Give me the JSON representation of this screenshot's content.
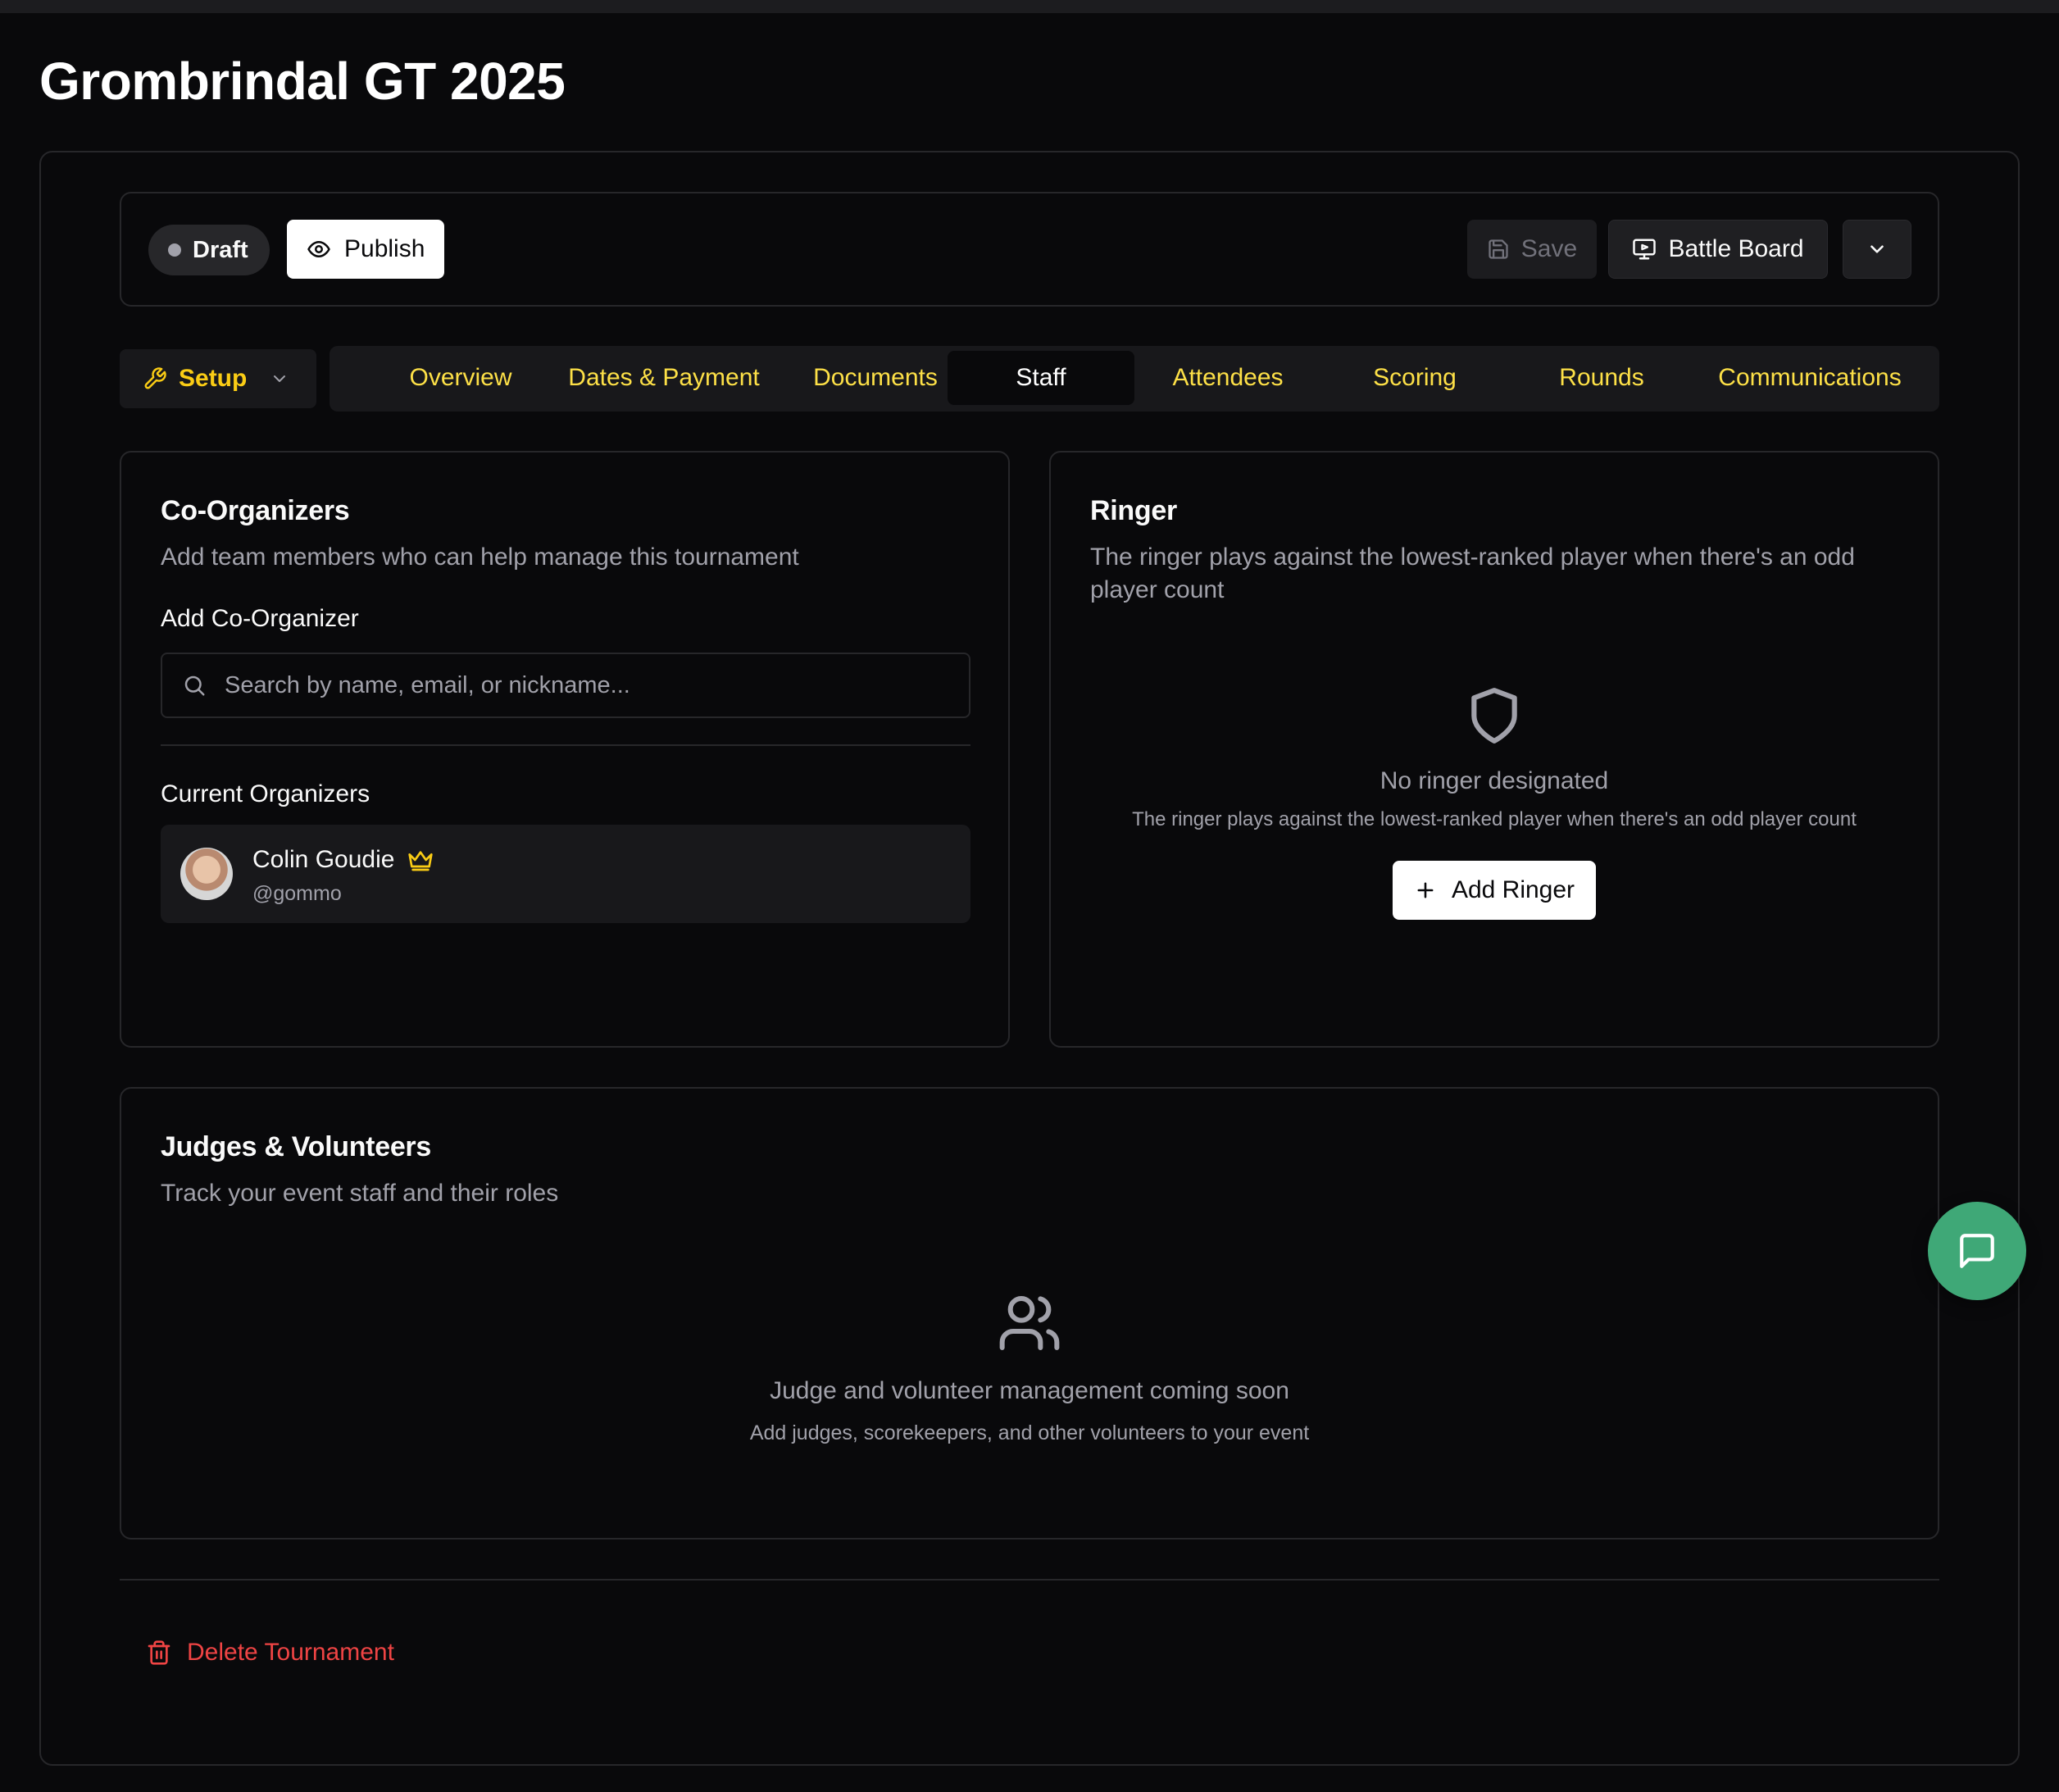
{
  "page": {
    "title": "Grombrindal GT 2025"
  },
  "toolbar": {
    "status_badge": "Draft",
    "publish_label": "Publish",
    "save_label": "Save",
    "battle_board_label": "Battle Board"
  },
  "nav": {
    "setup_label": "Setup",
    "tabs": [
      {
        "label": "Overview"
      },
      {
        "label": "Dates & Payment"
      },
      {
        "label": "Documents"
      },
      {
        "label": "Staff",
        "active": true
      },
      {
        "label": "Attendees"
      },
      {
        "label": "Scoring"
      },
      {
        "label": "Rounds"
      },
      {
        "label": "Communications"
      }
    ]
  },
  "co_organizers": {
    "title": "Co-Organizers",
    "description": "Add team members who can help manage this tournament",
    "add_label": "Add Co-Organizer",
    "search_placeholder": "Search by name, email, or nickname...",
    "current_label": "Current Organizers",
    "organizers": [
      {
        "name": "Colin Goudie",
        "handle": "@gommo",
        "role_icon": "crown-icon"
      }
    ]
  },
  "ringer": {
    "title": "Ringer",
    "description": "The ringer plays against the lowest-ranked player when there's an odd player count",
    "empty_title": "No ringer designated",
    "empty_description": "The ringer plays against the lowest-ranked player when there's an odd player count",
    "add_button": "Add Ringer"
  },
  "judges": {
    "title": "Judges & Volunteers",
    "description": "Track your event staff and their roles",
    "empty_title": "Judge and volunteer management coming soon",
    "empty_description": "Add judges, scorekeepers, and other volunteers to your event"
  },
  "danger": {
    "delete_label": "Delete Tournament"
  },
  "colors": {
    "background": "#09090b",
    "tab_accent": "#fde047",
    "danger": "#ef4444",
    "chat_fab": "#3fa877"
  }
}
